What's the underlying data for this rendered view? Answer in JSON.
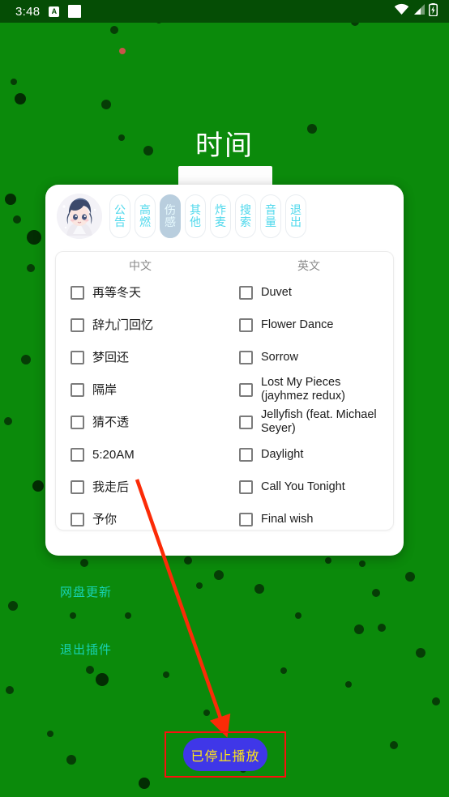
{
  "status_bar": {
    "time": "3:48",
    "app_icon_letter": "A",
    "icons": [
      "app-badge-icon",
      "blank-square-icon",
      "wifi-icon",
      "cellular-signal-icon",
      "battery-charging-icon"
    ]
  },
  "background": {
    "title": "时间",
    "links": [
      "网盘更新",
      "退出插件"
    ],
    "bg_color": "#0b8a0b",
    "status_bar_color": "#054d05",
    "link_color": "#18d3b4"
  },
  "dialog": {
    "avatar_alt": "anime-avatar",
    "tabs": [
      {
        "label": "公告",
        "c1": "公",
        "c2": "告",
        "selected": false
      },
      {
        "label": "高燃",
        "c1": "高",
        "c2": "燃",
        "selected": false
      },
      {
        "label": "伤感",
        "c1": "伤",
        "c2": "感",
        "selected": true
      },
      {
        "label": "其他",
        "c1": "其",
        "c2": "他",
        "selected": false
      },
      {
        "label": "炸麦",
        "c1": "炸",
        "c2": "麦",
        "selected": false
      },
      {
        "label": "搜索",
        "c1": "搜",
        "c2": "索",
        "selected": false
      },
      {
        "label": "音量",
        "c1": "音",
        "c2": "量",
        "selected": false
      },
      {
        "label": "退出",
        "c1": "退",
        "c2": "出",
        "selected": false
      }
    ],
    "tab_color": "#4fd8ec",
    "tab_selected_bg": "#b9cede",
    "columns": [
      {
        "header": "中文",
        "songs": [
          {
            "label": "再等冬天",
            "checked": false
          },
          {
            "label": "辞九门回忆",
            "checked": false
          },
          {
            "label": "梦回还",
            "checked": false
          },
          {
            "label": "隔岸",
            "checked": false
          },
          {
            "label": "猜不透",
            "checked": false
          },
          {
            "label": "5:20AM",
            "checked": false
          },
          {
            "label": "我走后",
            "checked": false
          },
          {
            "label": "予你",
            "checked": false
          }
        ]
      },
      {
        "header": "英文",
        "songs": [
          {
            "label": "Duvet",
            "checked": false
          },
          {
            "label": "Flower Dance",
            "checked": false
          },
          {
            "label": "Sorrow",
            "checked": false
          },
          {
            "label": "Lost My Pieces (jayhmez redux)",
            "checked": false
          },
          {
            "label": "Jellyfish (feat. Michael Seyer)",
            "checked": false
          },
          {
            "label": "Daylight",
            "checked": false
          },
          {
            "label": "Call You Tonight",
            "checked": false
          },
          {
            "label": "Final wish",
            "checked": false
          }
        ]
      }
    ]
  },
  "bottom": {
    "stop_button_label": "已停止播放",
    "button_bg": "#3f37e8",
    "button_text_color": "#ffe617",
    "annotation_color": "#fb0f0f"
  }
}
